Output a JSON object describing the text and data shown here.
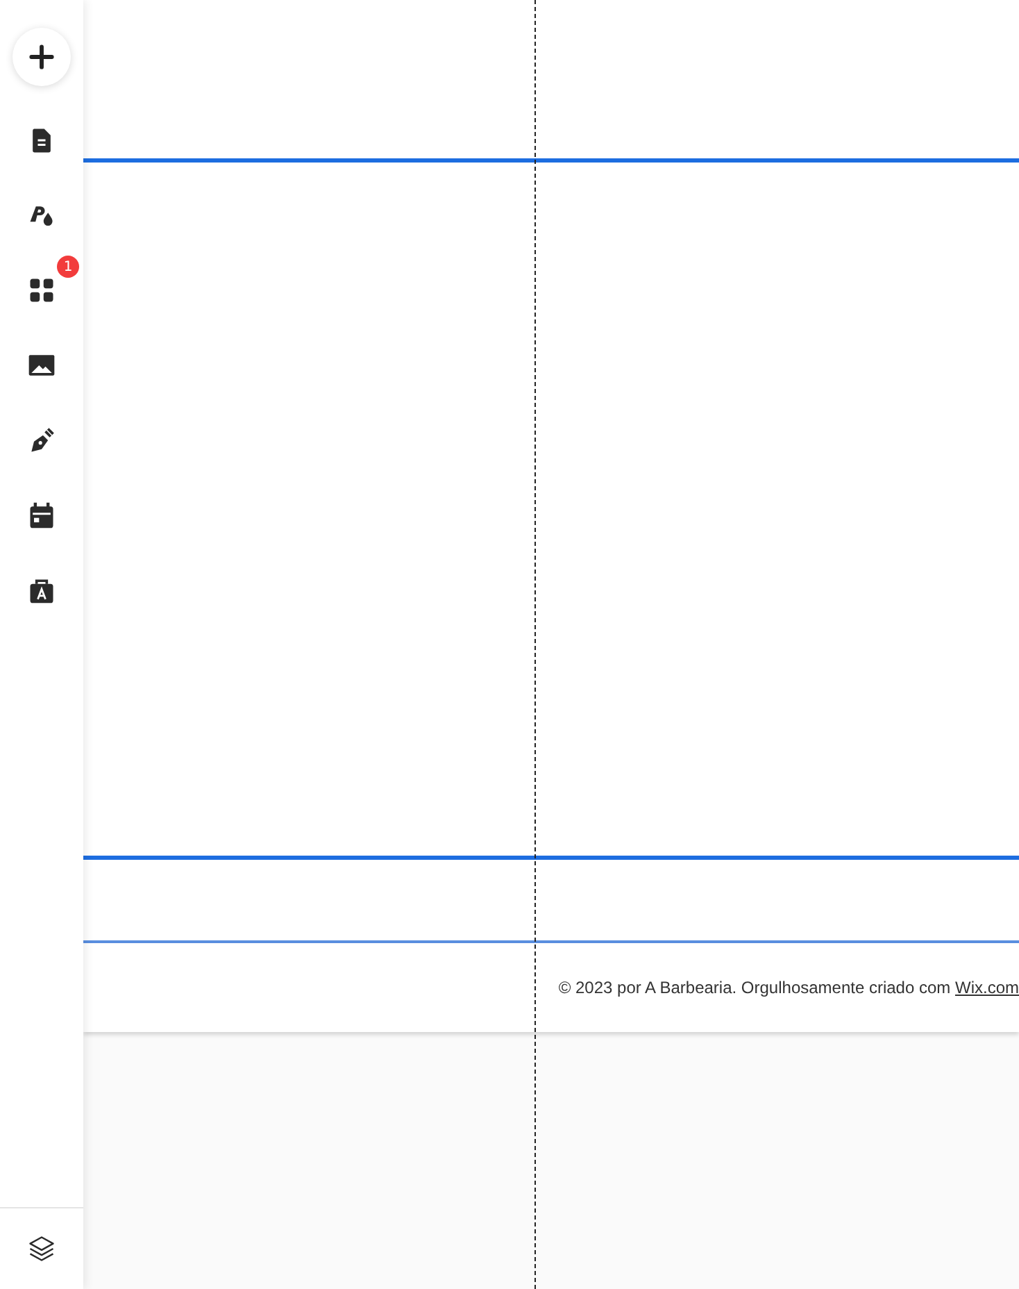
{
  "sidebar": {
    "tools": [
      {
        "kind": "add"
      },
      {
        "kind": "pages"
      },
      {
        "kind": "design"
      },
      {
        "kind": "apps",
        "badge": "1"
      },
      {
        "kind": "media"
      },
      {
        "kind": "pen"
      },
      {
        "kind": "calendar"
      },
      {
        "kind": "business"
      }
    ],
    "bottom_tool": {
      "kind": "layers"
    }
  },
  "footer": {
    "text": "© 2023 por A Barbearia. Orgulhosamente criado com ",
    "link": "Wix.com"
  }
}
